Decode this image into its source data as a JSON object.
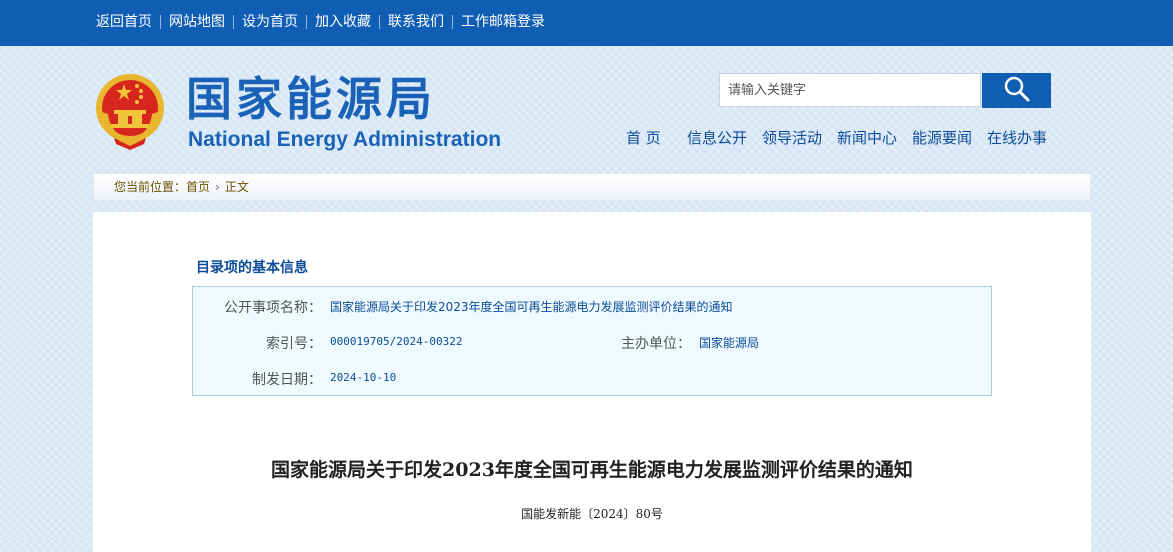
{
  "topbar": {
    "links": [
      "返回首页",
      "网站地图",
      "设为首页",
      "加入收藏",
      "联系我们",
      "工作邮箱登录"
    ]
  },
  "site": {
    "title_cn": "国家能源局",
    "title_en": "National Energy Administration"
  },
  "search": {
    "placeholder": "请输入关键字"
  },
  "nav": {
    "items": [
      "首 页",
      "信息公开",
      "领导活动",
      "新闻中心",
      "能源要闻",
      "在线办事"
    ]
  },
  "breadcrumb": {
    "prefix": "您当前位置：",
    "home": "首页",
    "current": "正文"
  },
  "catalog": {
    "title": "目录项的基本信息",
    "name_label": "公开事项名称：",
    "name_value": "国家能源局关于印发2023年度全国可再生能源电力发展监测评价结果的通知",
    "index_label": "索引号：",
    "index_value": "000019705/2024-00322",
    "unit_label": "主办单位：",
    "unit_value": "国家能源局",
    "date_label": "制发日期：",
    "date_value": "2024-10-10"
  },
  "document": {
    "title": "国家能源局关于印发2023年度全国可再生能源电力发展监测评价结果的通知",
    "number": "国能发新能〔2024〕80号"
  },
  "colors": {
    "brand_blue": "#0f5eb4",
    "title_blue": "#1a62b7",
    "emblem_red": "#d7261e",
    "emblem_gold": "#f3c33a"
  }
}
